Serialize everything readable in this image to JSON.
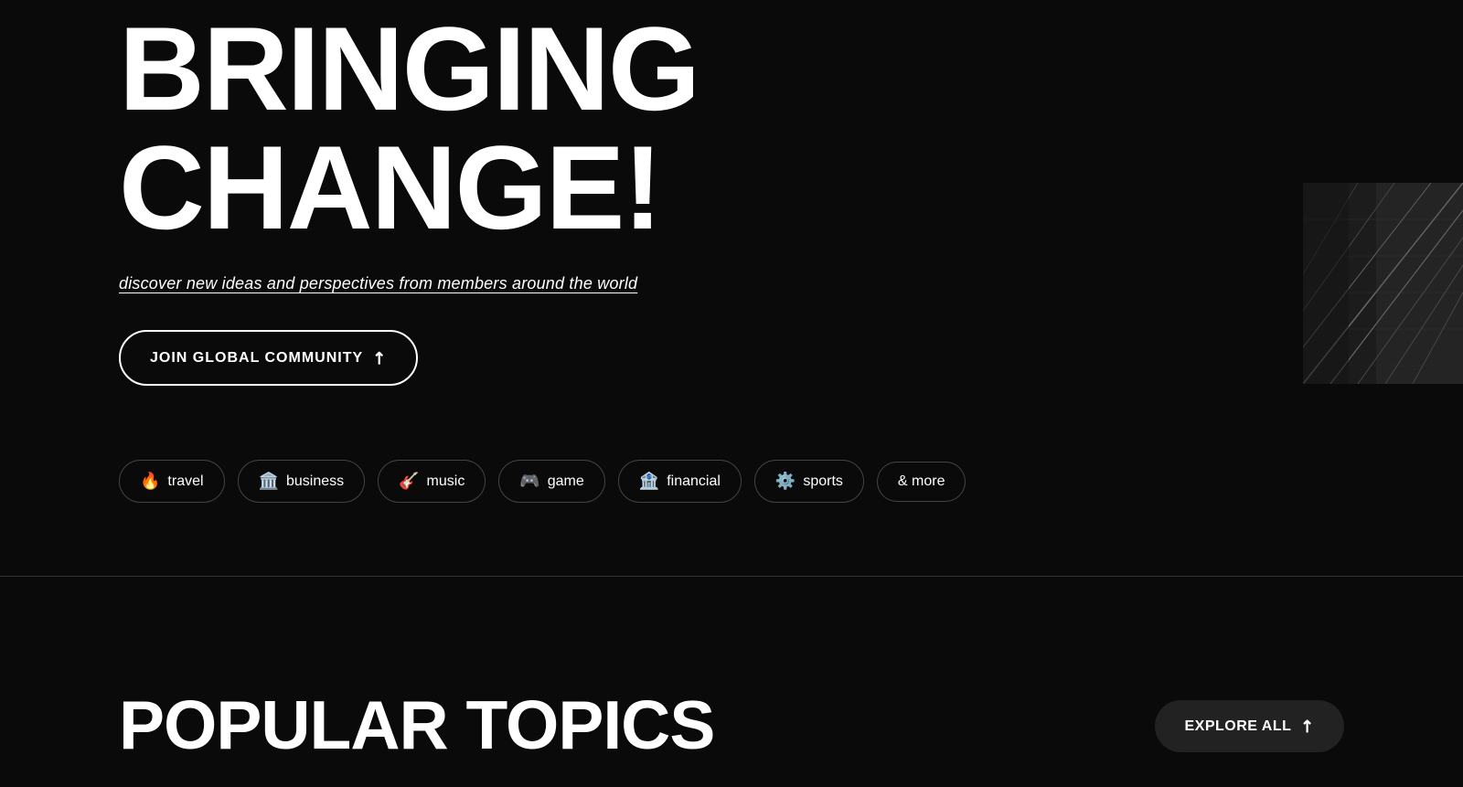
{
  "hero": {
    "title_line1": "BRINGING",
    "title_line2": "CHANGE!",
    "subtitle": "discover new ideas and perspectives from members around the world",
    "cta_label": "JOIN GLOBAL COMMUNITY",
    "cta_arrow": "↗"
  },
  "tags": [
    {
      "emoji": "🔥",
      "label": "travel"
    },
    {
      "emoji": "🏛️",
      "label": "business"
    },
    {
      "emoji": "🎸",
      "label": "music"
    },
    {
      "emoji": "🎮",
      "label": "game"
    },
    {
      "emoji": "🏦",
      "label": "financial"
    },
    {
      "emoji": "⚙️",
      "label": "sports"
    },
    {
      "label": "& more"
    }
  ],
  "bottom": {
    "popular_topics_title": "POPULAR TOPICS",
    "explore_all_label": "EXPLORE ALL",
    "explore_arrow": "↗"
  }
}
